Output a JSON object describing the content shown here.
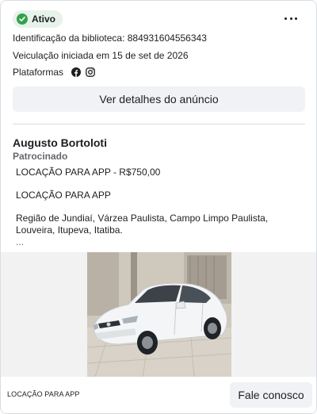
{
  "status": {
    "label": "Ativo",
    "color": "#31a24c"
  },
  "menu": {
    "icon": "more-horizontal-icon"
  },
  "meta": {
    "library_id": "Identificação da biblioteca: 884931604556343",
    "started": "Veiculação iniciada em 15 de set de 2026",
    "platforms_label": "Plataformas",
    "platforms": [
      "facebook-icon",
      "instagram-icon"
    ]
  },
  "details_button": "Ver detalhes do anúncio",
  "ad": {
    "advertiser": "Augusto Bortoloti",
    "sponsored": "Patrocinado",
    "lines": [
      "LOCAÇÃO PARA APP - R$750,00",
      "LOCAÇÃO PARA APP",
      "Região de Jundiaí, Várzea Paulista, Campo Limpo Paulista, Louveira, Itupeva, Itatiba.",
      "..."
    ],
    "image": "white-sedan-car-photo"
  },
  "footer": {
    "title": "LOCAÇÃO PARA APP",
    "cta": "Fale conosco"
  }
}
